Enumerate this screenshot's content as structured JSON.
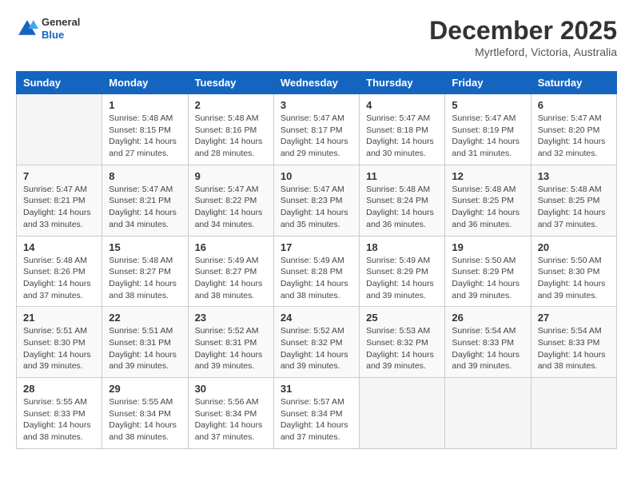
{
  "header": {
    "logo_line1": "General",
    "logo_line2": "Blue",
    "month_year": "December 2025",
    "location": "Myrtleford, Victoria, Australia"
  },
  "weekdays": [
    "Sunday",
    "Monday",
    "Tuesday",
    "Wednesday",
    "Thursday",
    "Friday",
    "Saturday"
  ],
  "weeks": [
    [
      {
        "day": "",
        "info": ""
      },
      {
        "day": "1",
        "info": "Sunrise: 5:48 AM\nSunset: 8:15 PM\nDaylight: 14 hours\nand 27 minutes."
      },
      {
        "day": "2",
        "info": "Sunrise: 5:48 AM\nSunset: 8:16 PM\nDaylight: 14 hours\nand 28 minutes."
      },
      {
        "day": "3",
        "info": "Sunrise: 5:47 AM\nSunset: 8:17 PM\nDaylight: 14 hours\nand 29 minutes."
      },
      {
        "day": "4",
        "info": "Sunrise: 5:47 AM\nSunset: 8:18 PM\nDaylight: 14 hours\nand 30 minutes."
      },
      {
        "day": "5",
        "info": "Sunrise: 5:47 AM\nSunset: 8:19 PM\nDaylight: 14 hours\nand 31 minutes."
      },
      {
        "day": "6",
        "info": "Sunrise: 5:47 AM\nSunset: 8:20 PM\nDaylight: 14 hours\nand 32 minutes."
      }
    ],
    [
      {
        "day": "7",
        "info": "Sunrise: 5:47 AM\nSunset: 8:21 PM\nDaylight: 14 hours\nand 33 minutes."
      },
      {
        "day": "8",
        "info": "Sunrise: 5:47 AM\nSunset: 8:21 PM\nDaylight: 14 hours\nand 34 minutes."
      },
      {
        "day": "9",
        "info": "Sunrise: 5:47 AM\nSunset: 8:22 PM\nDaylight: 14 hours\nand 34 minutes."
      },
      {
        "day": "10",
        "info": "Sunrise: 5:47 AM\nSunset: 8:23 PM\nDaylight: 14 hours\nand 35 minutes."
      },
      {
        "day": "11",
        "info": "Sunrise: 5:48 AM\nSunset: 8:24 PM\nDaylight: 14 hours\nand 36 minutes."
      },
      {
        "day": "12",
        "info": "Sunrise: 5:48 AM\nSunset: 8:25 PM\nDaylight: 14 hours\nand 36 minutes."
      },
      {
        "day": "13",
        "info": "Sunrise: 5:48 AM\nSunset: 8:25 PM\nDaylight: 14 hours\nand 37 minutes."
      }
    ],
    [
      {
        "day": "14",
        "info": "Sunrise: 5:48 AM\nSunset: 8:26 PM\nDaylight: 14 hours\nand 37 minutes."
      },
      {
        "day": "15",
        "info": "Sunrise: 5:48 AM\nSunset: 8:27 PM\nDaylight: 14 hours\nand 38 minutes."
      },
      {
        "day": "16",
        "info": "Sunrise: 5:49 AM\nSunset: 8:27 PM\nDaylight: 14 hours\nand 38 minutes."
      },
      {
        "day": "17",
        "info": "Sunrise: 5:49 AM\nSunset: 8:28 PM\nDaylight: 14 hours\nand 38 minutes."
      },
      {
        "day": "18",
        "info": "Sunrise: 5:49 AM\nSunset: 8:29 PM\nDaylight: 14 hours\nand 39 minutes."
      },
      {
        "day": "19",
        "info": "Sunrise: 5:50 AM\nSunset: 8:29 PM\nDaylight: 14 hours\nand 39 minutes."
      },
      {
        "day": "20",
        "info": "Sunrise: 5:50 AM\nSunset: 8:30 PM\nDaylight: 14 hours\nand 39 minutes."
      }
    ],
    [
      {
        "day": "21",
        "info": "Sunrise: 5:51 AM\nSunset: 8:30 PM\nDaylight: 14 hours\nand 39 minutes."
      },
      {
        "day": "22",
        "info": "Sunrise: 5:51 AM\nSunset: 8:31 PM\nDaylight: 14 hours\nand 39 minutes."
      },
      {
        "day": "23",
        "info": "Sunrise: 5:52 AM\nSunset: 8:31 PM\nDaylight: 14 hours\nand 39 minutes."
      },
      {
        "day": "24",
        "info": "Sunrise: 5:52 AM\nSunset: 8:32 PM\nDaylight: 14 hours\nand 39 minutes."
      },
      {
        "day": "25",
        "info": "Sunrise: 5:53 AM\nSunset: 8:32 PM\nDaylight: 14 hours\nand 39 minutes."
      },
      {
        "day": "26",
        "info": "Sunrise: 5:54 AM\nSunset: 8:33 PM\nDaylight: 14 hours\nand 39 minutes."
      },
      {
        "day": "27",
        "info": "Sunrise: 5:54 AM\nSunset: 8:33 PM\nDaylight: 14 hours\nand 38 minutes."
      }
    ],
    [
      {
        "day": "28",
        "info": "Sunrise: 5:55 AM\nSunset: 8:33 PM\nDaylight: 14 hours\nand 38 minutes."
      },
      {
        "day": "29",
        "info": "Sunrise: 5:55 AM\nSunset: 8:34 PM\nDaylight: 14 hours\nand 38 minutes."
      },
      {
        "day": "30",
        "info": "Sunrise: 5:56 AM\nSunset: 8:34 PM\nDaylight: 14 hours\nand 37 minutes."
      },
      {
        "day": "31",
        "info": "Sunrise: 5:57 AM\nSunset: 8:34 PM\nDaylight: 14 hours\nand 37 minutes."
      },
      {
        "day": "",
        "info": ""
      },
      {
        "day": "",
        "info": ""
      },
      {
        "day": "",
        "info": ""
      }
    ]
  ]
}
